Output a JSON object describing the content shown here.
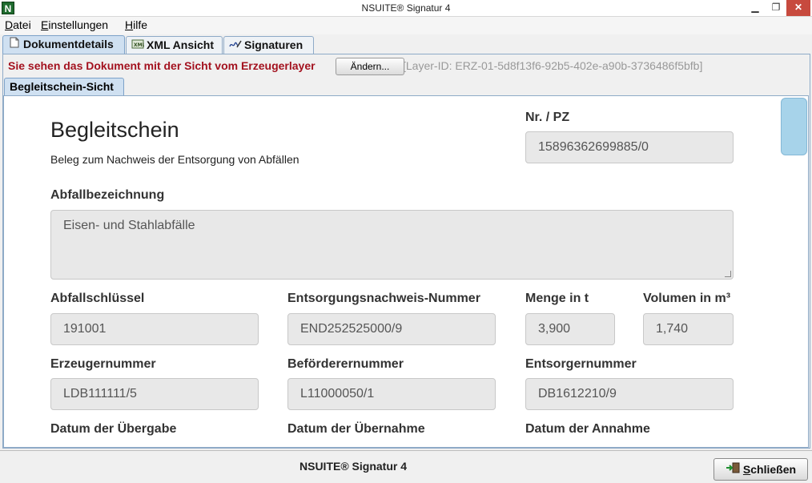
{
  "window": {
    "icon_letter": "N",
    "title": "NSUITE® Signatur 4",
    "minimize": "▁",
    "maximize": "❐",
    "close": "✕"
  },
  "menu": {
    "datei_acc": "D",
    "datei_rest": "atei",
    "einst_acc": "E",
    "einst_rest": "instellungen",
    "hilfe_acc": "H",
    "hilfe_rest": "ilfe"
  },
  "tabs": [
    {
      "label": "Dokumentdetails",
      "icon": "document-icon"
    },
    {
      "label": "XML Ansicht",
      "icon": "xml-icon"
    },
    {
      "label": "Signaturen",
      "icon": "signature-icon"
    }
  ],
  "layer": {
    "message": "Sie sehen das Dokument mit der Sicht vom Erzeugerlayer",
    "change_button": "Ändern...",
    "layer_id": "[Layer-ID: ERZ-01-5d8f13f6-92b5-402e-a90b-3736486f5bfb]"
  },
  "inner_tab": "Begleitschein-Sicht",
  "form": {
    "title": "Begleitschein",
    "subtitle": "Beleg zum Nachweis der Entsorgung von Abfällen",
    "nr_label": "Nr. / PZ",
    "nr_value": "15896362699885/0",
    "abfallbezeichnung_label": "Abfallbezeichnung",
    "abfallbezeichnung_value": "Eisen- und Stahlabfälle",
    "abfallschluessel_label": "Abfallschlüssel",
    "abfallschluessel_value": "191001",
    "entsorgungsnachweis_label": "Entsorgungsnachweis-Nummer",
    "entsorgungsnachweis_value": "END252525000/9",
    "menge_label": "Menge in t",
    "menge_value": "3,900",
    "volumen_label": "Volumen in m³",
    "volumen_value": "1,740",
    "erzeuger_label": "Erzeugernummer",
    "erzeuger_value": "LDB111111/5",
    "befoerderer_label": "Beförderernummer",
    "befoerderer_value": "L11000050/1",
    "entsorger_label": "Entsorgernummer",
    "entsorger_value": "DB1612210/9",
    "datum_uebergabe_label": "Datum der Übergabe",
    "datum_uebernahme_label": "Datum der Übernahme",
    "datum_annahme_label": "Datum der Annahme"
  },
  "status": {
    "text": "NSUITE® Signatur 4",
    "close_acc": "S",
    "close_rest": "chließen"
  }
}
